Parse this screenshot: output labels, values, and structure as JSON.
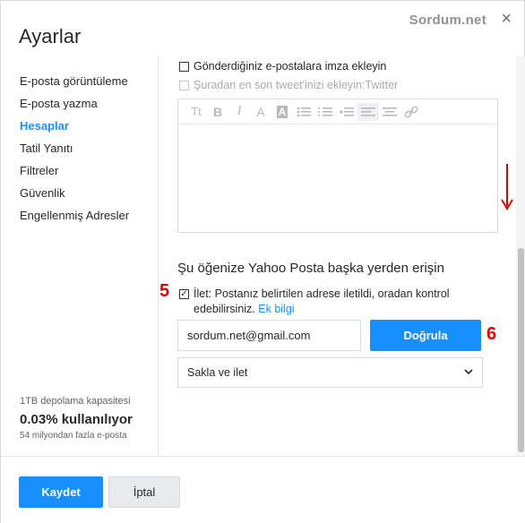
{
  "header": {
    "title": "Ayarlar",
    "watermark": "Sordum.net",
    "close_icon": "×"
  },
  "sidebar": {
    "items": [
      {
        "label": "E-posta görüntüleme",
        "active": false
      },
      {
        "label": "E-posta yazma",
        "active": false
      },
      {
        "label": "Hesaplar",
        "active": true
      },
      {
        "label": "Tatil Yanıtı",
        "active": false
      },
      {
        "label": "Filtreler",
        "active": false
      },
      {
        "label": "Güvenlik",
        "active": false
      },
      {
        "label": "Engellenmiş Adresler",
        "active": false
      }
    ],
    "storage": {
      "capacity": "1TB depolama kapasitesi",
      "used": "0.03% kullanılıyor",
      "note": "54 milyondan fazla e-posta"
    }
  },
  "signature": {
    "sign_sent_label": "Gönderdiğiniz e-postalara imza ekleyin",
    "sign_sent_checked": false,
    "tweet_label": "Şuradan en son tweet'inizi ekleyin:Twitter",
    "tweet_checked": false,
    "tweet_disabled": true,
    "toolbar": [
      "font-size-icon",
      "bold-icon",
      "italic-icon",
      "text-color-icon",
      "highlight-icon",
      "bulleted-list-icon",
      "numbered-list-icon",
      "outdent-icon",
      "align-left-icon",
      "align-center-icon",
      "link-icon"
    ]
  },
  "forwarding": {
    "section_title": "Şu öğenize Yahoo Posta başka yerden erişin",
    "forward_label": "İlet: Postanız belirtilen adrese iletildi, oradan kontrol edebilirsiniz.",
    "forward_checked": true,
    "more_info": "Ek bilgi",
    "email_value": "sordum.net@gmail.com",
    "verify_label": "Doğrula",
    "option_selected": "Sakla ve ilet"
  },
  "annotations": {
    "step5": "5",
    "step6": "6",
    "color": "#e00000"
  },
  "footer": {
    "save_label": "Kaydet",
    "cancel_label": "İptal"
  },
  "colors": {
    "accent": "#188fff"
  }
}
